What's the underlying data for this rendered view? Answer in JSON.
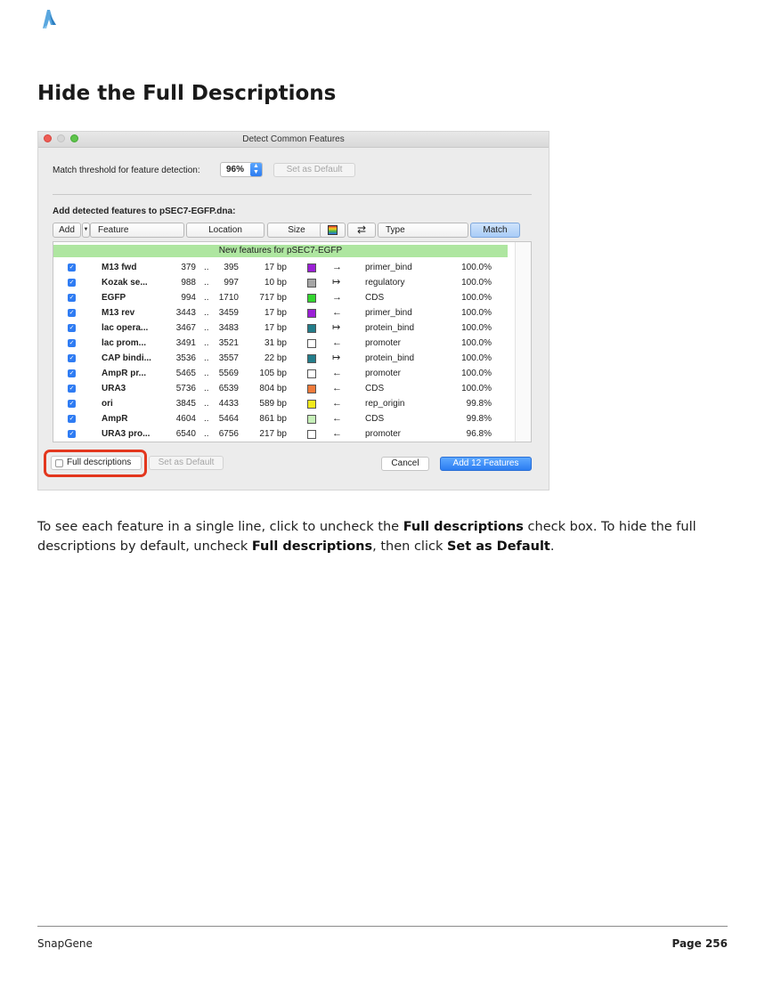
{
  "page": {
    "title": "Hide the Full Descriptions",
    "body": {
      "t1": "To see each feature in a single line, click to uncheck the ",
      "b1": "Full descriptions",
      "t2": " check box. To hide the full descriptions by default, uncheck ",
      "b2": "Full descriptions",
      "t3": ", then click ",
      "b3": "Set as Default",
      "t4": "."
    },
    "footer": {
      "left": "SnapGene",
      "right": "Page 256"
    }
  },
  "dialog": {
    "title": "Detect Common Features",
    "threshold_label": "Match threshold for feature detection:",
    "threshold_value": "96%",
    "set_default_top": "Set as Default",
    "add_label": "Add detected features to pSEC7-EGFP.dna:",
    "columns": {
      "add": "Add",
      "feature": "Feature",
      "location": "Location",
      "size": "Size",
      "direction_icon": "⇄",
      "type": "Type",
      "match": "Match"
    },
    "group_header": "New features for pSEC7-EGFP",
    "rows": [
      {
        "name": "M13 fwd",
        "start": "379",
        "end": "395",
        "size": "17 bp",
        "color": "#9b1fd6",
        "dir": "→",
        "type": "primer_bind",
        "match": "100.0%"
      },
      {
        "name": "Kozak se...",
        "start": "988",
        "end": "997",
        "size": "10 bp",
        "color": "#a6a6a6",
        "dir": "↦",
        "type": "regulatory",
        "match": "100.0%"
      },
      {
        "name": "EGFP",
        "start": "994",
        "end": "1710",
        "size": "717 bp",
        "color": "#33d62f",
        "dir": "→",
        "type": "CDS",
        "match": "100.0%"
      },
      {
        "name": "M13 rev",
        "start": "3443",
        "end": "3459",
        "size": "17 bp",
        "color": "#9b1fd6",
        "dir": "←",
        "type": "primer_bind",
        "match": "100.0%"
      },
      {
        "name": "lac opera...",
        "start": "3467",
        "end": "3483",
        "size": "17 bp",
        "color": "#237d8a",
        "dir": "↦",
        "type": "protein_bind",
        "match": "100.0%"
      },
      {
        "name": "lac prom...",
        "start": "3491",
        "end": "3521",
        "size": "31 bp",
        "color": "#ffffff",
        "dir": "←",
        "type": "promoter",
        "match": "100.0%"
      },
      {
        "name": "CAP bindi...",
        "start": "3536",
        "end": "3557",
        "size": "22 bp",
        "color": "#237d8a",
        "dir": "↦",
        "type": "protein_bind",
        "match": "100.0%"
      },
      {
        "name": "AmpR pr...",
        "start": "5465",
        "end": "5569",
        "size": "105 bp",
        "color": "#ffffff",
        "dir": "←",
        "type": "promoter",
        "match": "100.0%"
      },
      {
        "name": "URA3",
        "start": "5736",
        "end": "6539",
        "size": "804 bp",
        "color": "#f07a3a",
        "dir": "←",
        "type": "CDS",
        "match": "100.0%"
      },
      {
        "name": "ori",
        "start": "3845",
        "end": "4433",
        "size": "589 bp",
        "color": "#f2ea1c",
        "dir": "←",
        "type": "rep_origin",
        "match": "99.8%"
      },
      {
        "name": "AmpR",
        "start": "4604",
        "end": "5464",
        "size": "861 bp",
        "color": "#c6f0b8",
        "dir": "←",
        "type": "CDS",
        "match": "99.8%"
      },
      {
        "name": "URA3 pro...",
        "start": "6540",
        "end": "6756",
        "size": "217 bp",
        "color": "#ffffff",
        "dir": "←",
        "type": "promoter",
        "match": "96.8%"
      }
    ],
    "full_descriptions_label": "Full descriptions",
    "set_default_bottom": "Set as Default",
    "cancel": "Cancel",
    "add_features": "Add 12 Features"
  }
}
